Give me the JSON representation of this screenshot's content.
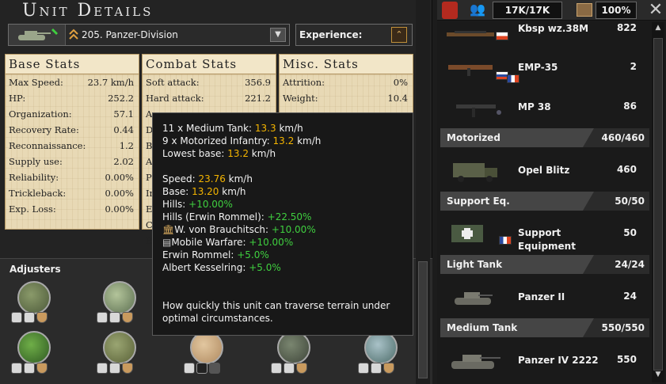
{
  "header": {
    "title": "Unit Details"
  },
  "division": {
    "name": "205. Panzer-Division",
    "experience_label": "Experience:"
  },
  "base_stats": {
    "title": "Base Stats",
    "rows": [
      {
        "label": "Max Speed:",
        "value": "23.7 km/h"
      },
      {
        "label": "HP:",
        "value": "252.2"
      },
      {
        "label": "Organization:",
        "value": "57.1"
      },
      {
        "label": "Recovery Rate:",
        "value": "0.44"
      },
      {
        "label": "Reconnaissance:",
        "value": "1.2"
      },
      {
        "label": "Supply use:",
        "value": "2.02"
      },
      {
        "label": "Reliability:",
        "value": "0.00%"
      },
      {
        "label": "Trickleback:",
        "value": "0.00%"
      },
      {
        "label": "Exp. Loss:",
        "value": "0.00%"
      }
    ]
  },
  "combat_stats": {
    "title": "Combat Stats",
    "rows": [
      {
        "label": "Soft attack:",
        "value": "356.9"
      },
      {
        "label": "Hard attack:",
        "value": "221.2"
      },
      {
        "label": "A",
        "value": ""
      },
      {
        "label": "D",
        "value": ""
      },
      {
        "label": "B",
        "value": ""
      },
      {
        "label": "A",
        "value": ""
      },
      {
        "label": "P",
        "value": ""
      },
      {
        "label": "Ir",
        "value": ""
      },
      {
        "label": "E",
        "value": ""
      },
      {
        "label": "C",
        "value": ""
      },
      {
        "label": "E",
        "value": ""
      }
    ]
  },
  "misc_stats": {
    "title": "Misc. Stats",
    "rows": [
      {
        "label": "Attrition:",
        "value": "0%"
      },
      {
        "label": "Weight:",
        "value": "10.4"
      }
    ]
  },
  "adjusters": {
    "title": "Adjusters"
  },
  "tooltip": {
    "l1_pre": "11 x Medium Tank: ",
    "l1_val": "13.3",
    "l1_unit": " km/h",
    "l2_pre": "9 x Motorized Infantry: ",
    "l2_val": "13.2",
    "l2_unit": " km/h",
    "l3_pre": "Lowest base: ",
    "l3_val": "13.2",
    "l3_unit": " km/h",
    "speed_pre": "Speed: ",
    "speed_val": "23.76",
    "speed_unit": " km/h",
    "base_pre": "Base: ",
    "base_val": "13.20",
    "base_unit": " km/h",
    "hills_pre": "Hills: ",
    "hills_val": "+10.00%",
    "hr_pre": "Hills (Erwin Rommel): ",
    "hr_val": "+22.50%",
    "wb_pre": "W. von Brauchitsch: ",
    "wb_val": "+10.00%",
    "mw_pre": "Mobile Warfare: ",
    "mw_val": "+10.00%",
    "er_pre": "Erwin Rommel: ",
    "er_val": "+5.0%",
    "ak_pre": "Albert Kesselring: ",
    "ak_val": "+5.0%",
    "desc1": "How quickly this unit can traverse terrain under",
    "desc2": "optimal circumstances."
  },
  "resources": {
    "manpower": "17K/17K",
    "equipment_pct": "100%"
  },
  "equipment": {
    "kbsp": {
      "name": "Kbsp wz.38M",
      "value": "822"
    },
    "emp": {
      "name": "EMP-35",
      "value": "2"
    },
    "mp38": {
      "name": "MP 38",
      "value": "86"
    },
    "motorized": {
      "name": "Motorized",
      "value": "460/460"
    },
    "opel": {
      "name": "Opel Blitz",
      "value": "460"
    },
    "support_cat": {
      "name": "Support Eq.",
      "value": "50/50"
    },
    "support": {
      "name1": "Support",
      "name2": "Equipment",
      "value": "50"
    },
    "light_cat": {
      "name": "Light Tank",
      "value": "24/24"
    },
    "pz2": {
      "name": "Panzer II",
      "value": "24"
    },
    "medium_cat": {
      "name": "Medium Tank",
      "value": "550/550"
    },
    "pz4": {
      "name": "Panzer IV 2222",
      "value": "550"
    }
  },
  "colors": {
    "highlight": "#f4b400",
    "positive": "#3fcf3f",
    "parchment": "#e8d9b5"
  }
}
